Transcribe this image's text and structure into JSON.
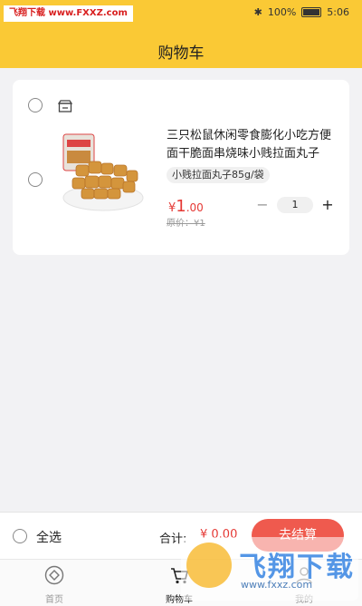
{
  "status_bar": {
    "watermark": "飞翔下载 www.FXXZ.com",
    "battery": "100%",
    "time": "5:06"
  },
  "header": {
    "title": "购物车"
  },
  "cart": {
    "items": [
      {
        "name": "三只松鼠休闲零食膨化小吃方便面干脆面串烧味小贱拉面丸子",
        "spec": "小贱拉面丸子85g/袋",
        "price_currency": "¥",
        "price_int": "1",
        "price_dec": ".00",
        "original_price": "原价：¥1",
        "quantity": "1",
        "minus": "−",
        "plus": "+"
      }
    ]
  },
  "checkout_bar": {
    "select_all": "全选",
    "total_label": "合计:",
    "total_amount": "¥ 0.00",
    "checkout_button": "去结算"
  },
  "tabs": [
    {
      "label": "首页",
      "icon": "home-icon"
    },
    {
      "label": "购物车",
      "icon": "cart-icon",
      "active": true
    },
    {
      "label": "我的",
      "icon": "profile-icon"
    }
  ],
  "corner_watermark": {
    "text": "飞翔下载",
    "url": "www.fxxz.com"
  },
  "colors": {
    "header_bg": "#fac935",
    "price_red": "#e53935",
    "checkout_button": "#ef5a4e"
  }
}
